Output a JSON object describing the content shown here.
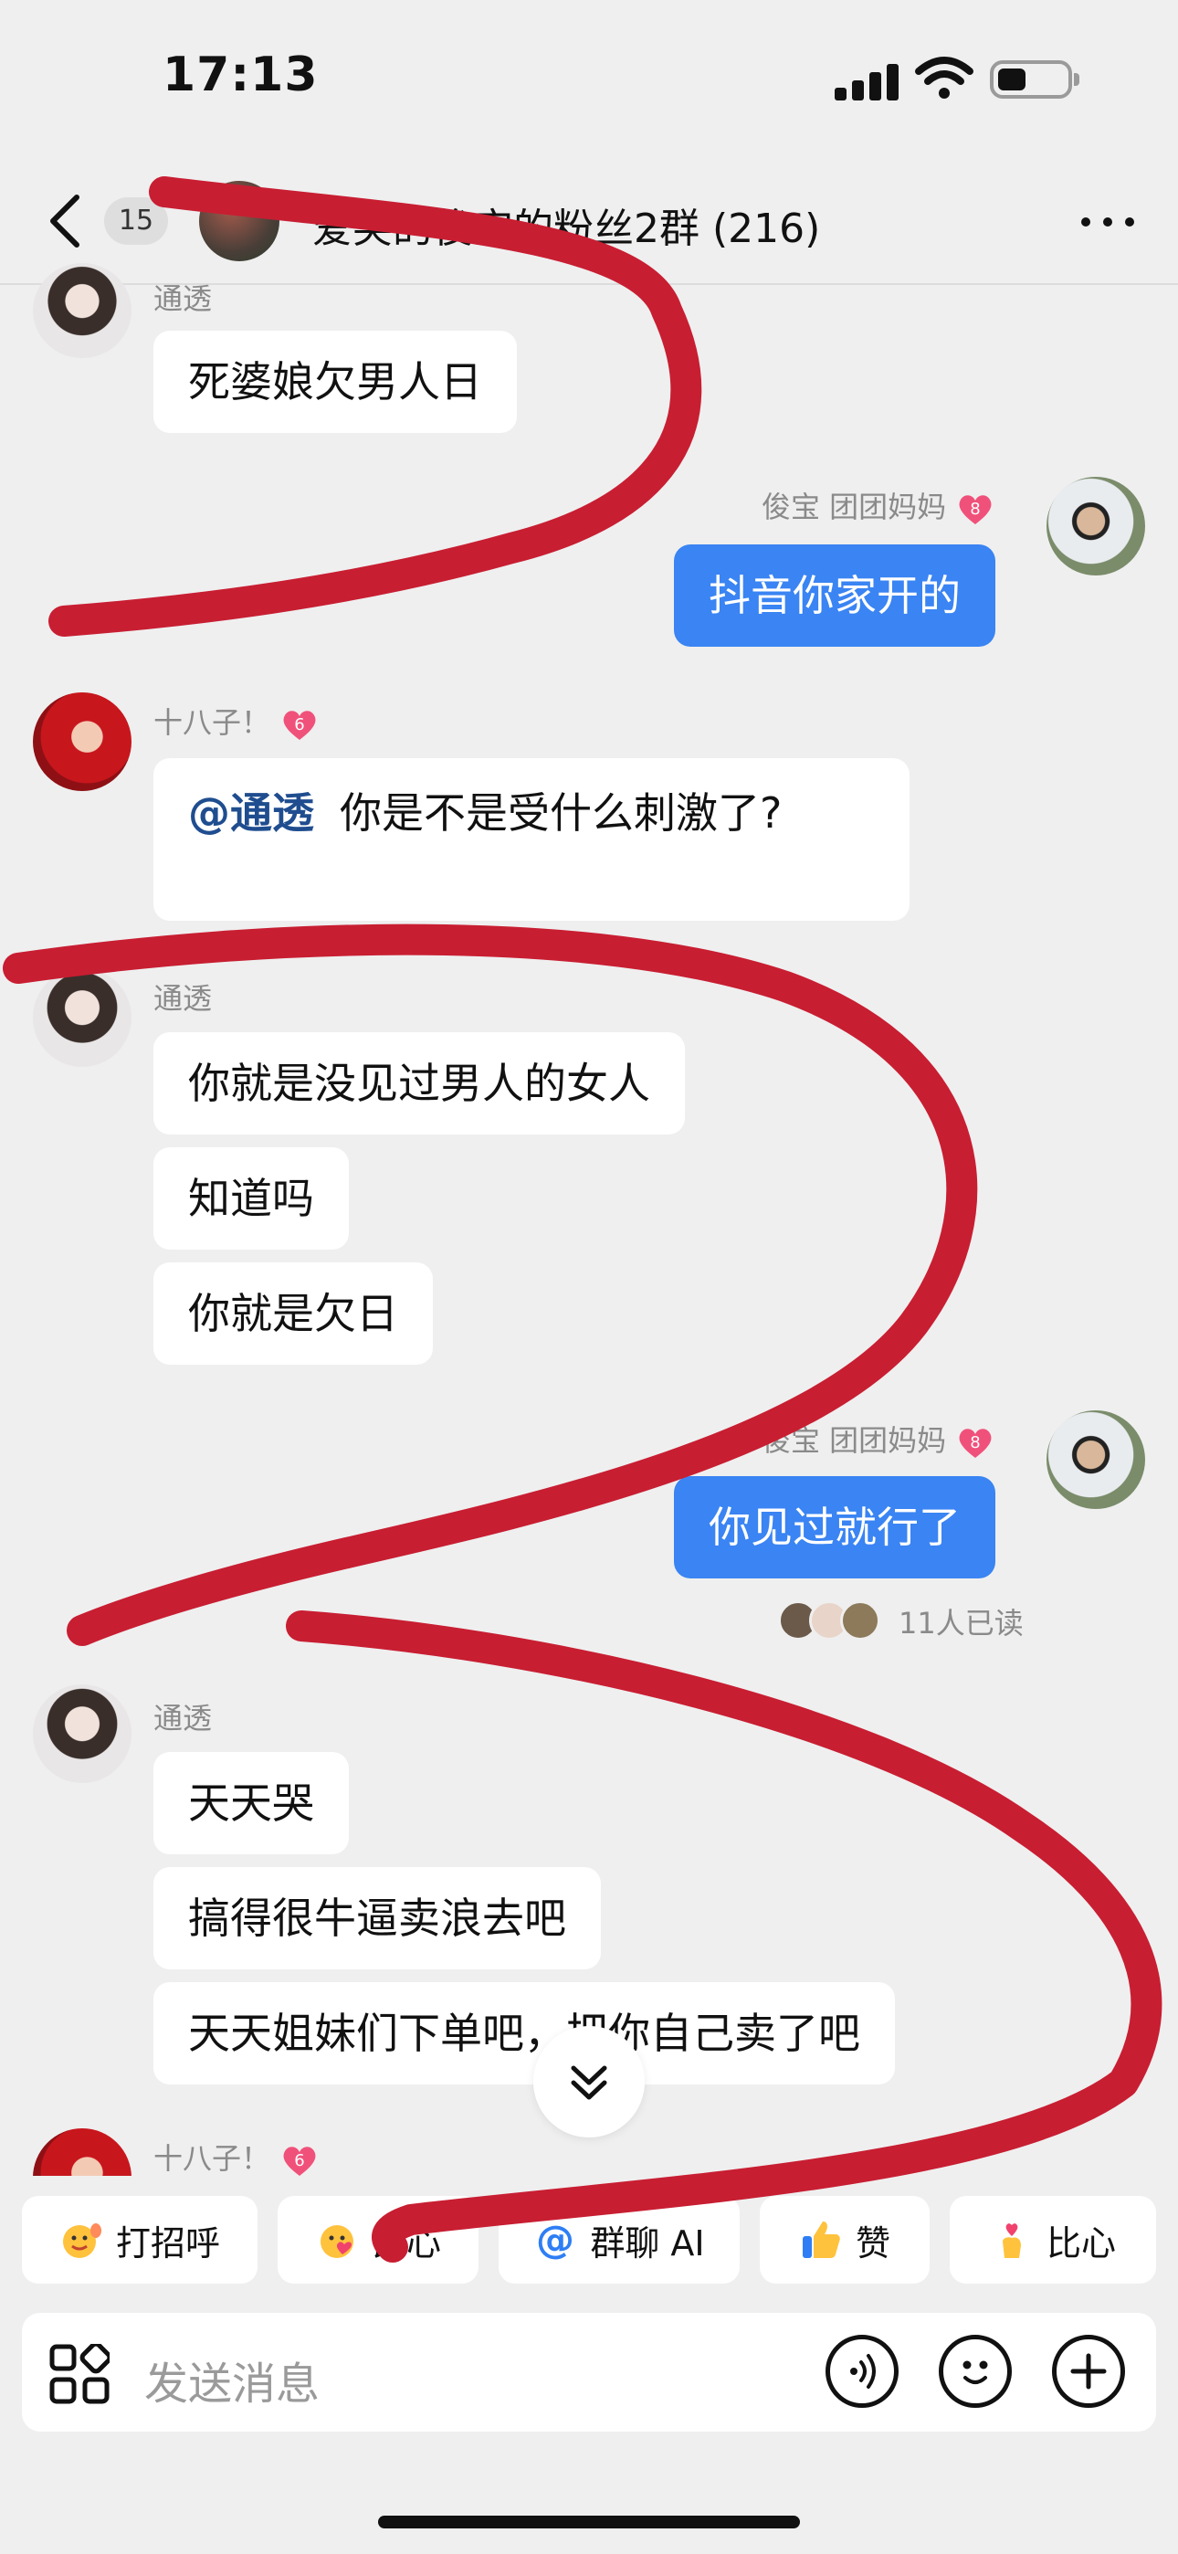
{
  "status_bar": {
    "time": "17:13"
  },
  "header": {
    "unread_count": "15",
    "title": "爱笑的俊宝的粉丝2群 (216)"
  },
  "messages": {
    "m1": {
      "sender": "通透",
      "text": "死婆娘欠男人日"
    },
    "m2": {
      "sender": "俊宝 团团妈妈",
      "level": "8",
      "text": "抖音你家开的"
    },
    "m3": {
      "sender": "十八子！",
      "level": "6",
      "mention": "@通透",
      "text": "你是不是受什么刺激了?"
    },
    "m4": {
      "sender": "通透",
      "lines": [
        "你就是没见过男人的女人",
        "知道吗",
        "你就是欠日"
      ]
    },
    "m5": {
      "sender": "俊宝 团团妈妈",
      "level": "8",
      "text": "你见过就行了",
      "read": "11人已读"
    },
    "m6": {
      "sender": "通透",
      "lines": [
        "天天哭",
        "搞得很牛逼卖浪去吧",
        "天天姐妹们下单吧，把你自己卖了吧"
      ]
    },
    "m7": {
      "sender": "十八子！",
      "level": "6"
    }
  },
  "quick_replies": [
    "打招呼",
    "比心",
    "群聊 AI",
    "赞",
    "比心"
  ],
  "input": {
    "placeholder": "发送消息"
  },
  "icons": {
    "back": "back-chevron-icon",
    "more": "more-dots-icon",
    "apps": "apps-grid-icon",
    "voice": "voice-icon",
    "emoji": "emoji-icon",
    "plus": "plus-icon",
    "scroll": "scroll-down-icon"
  },
  "colors": {
    "accent_blue": "#3a84f3",
    "mention_blue": "#1f4d8f",
    "scribble_red": "#c81e32",
    "level_pink": "#f0517a"
  }
}
